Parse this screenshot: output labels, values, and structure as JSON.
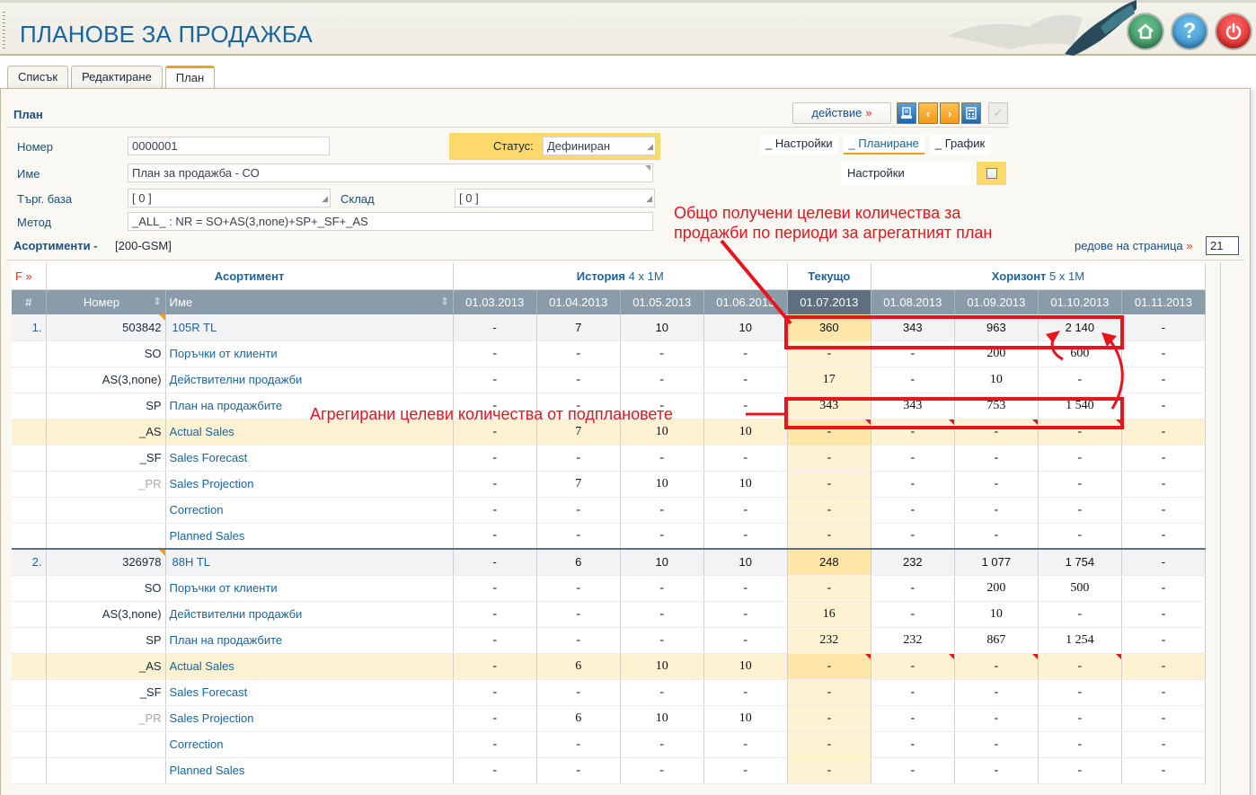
{
  "app": {
    "title": "ПЛАНОВЕ ЗА ПРОДАЖБА",
    "header_buttons": [
      {
        "name": "home",
        "icon": "home-icon"
      },
      {
        "name": "help",
        "icon": "help-icon",
        "glyph": "?"
      },
      {
        "name": "power",
        "icon": "power-icon"
      }
    ]
  },
  "tabs": [
    {
      "label": "Списък",
      "active": false
    },
    {
      "label": "Редактиране",
      "active": false
    },
    {
      "label": "План",
      "active": true
    }
  ],
  "plan": {
    "section_title": "План",
    "action_label": "действие",
    "action_suffix": "»",
    "toolbar": [
      "print-icon",
      "chevron-left-icon",
      "chevron-right-icon",
      "calculator-icon",
      "check-icon"
    ],
    "fields": {
      "number_label": "Номер",
      "number_value": "0000001",
      "status_label": "Статус:",
      "status_value": "Дефиниран",
      "name_label": "Име",
      "name_value": "План за продажба - СО",
      "trade_base_label": "Търг. база",
      "trade_base_value": "[ 0 ]",
      "warehouse_label": "Склад",
      "warehouse_value": "[ 0 ]",
      "method_label": "Метод",
      "method_value": "_ALL_ : NR = SO+AS(3,none)+SP+_SF+_AS"
    },
    "subtabs": [
      {
        "label": "_ Настройки",
        "active": false
      },
      {
        "label": "_ Планиране",
        "active": true
      },
      {
        "label": "_ График",
        "active": false
      }
    ],
    "settings_label": "Настройки",
    "settings_checked": false
  },
  "assortments": {
    "title": "Асортименти -",
    "code": "[200-GSM]",
    "rows_per_page_label": "редове на страница",
    "rows_per_page_suffix": "»",
    "rows_per_page_value": "21"
  },
  "annotations": {
    "top": [
      "Общо получени целеви количества за",
      "продажби по периоди за агрегатният план"
    ],
    "middle": "Агрегирани целеви количества от подплановете"
  },
  "grid": {
    "filter_label": "F »",
    "group_headers": {
      "assortment": "Асортимент",
      "history": "История",
      "history_detail": "4 x 1M",
      "current": "Текущо",
      "horizon": "Хоризонт",
      "horizon_detail": "5 x 1M"
    },
    "columns": {
      "index": "#",
      "number": "Номер",
      "name": "Име",
      "periods": [
        "01.03.2013",
        "01.04.2013",
        "01.05.2013",
        "01.06.2013",
        "01.07.2013",
        "01.08.2013",
        "01.09.2013",
        "01.10.2013",
        "01.11.2013"
      ],
      "current_period_index": 4
    },
    "items": [
      {
        "index": "1.",
        "number": "503842",
        "name": "105R TL",
        "values": [
          "-",
          "7",
          "10",
          "10",
          "360",
          "343",
          "963",
          "2 140",
          "-"
        ],
        "rows": [
          {
            "code": "SO",
            "name": "Поръчки от клиенти",
            "values": [
              "-",
              "-",
              "-",
              "-",
              "-",
              "-",
              "200",
              "600",
              "-"
            ]
          },
          {
            "code": "AS(3,none)",
            "name": "Действителни продажби",
            "values": [
              "-",
              "-",
              "-",
              "-",
              "17",
              "-",
              "10",
              "-",
              "-"
            ]
          },
          {
            "code": "SP",
            "name": "План на продажбите",
            "values": [
              "-",
              "-",
              "-",
              "-",
              "343",
              "343",
              "753",
              "1 540",
              "-"
            ]
          },
          {
            "code": "_AS",
            "name": "Actual Sales",
            "values": [
              "-",
              "7",
              "10",
              "10",
              "-",
              "-",
              "-",
              "-",
              "-"
            ],
            "highlight": true
          },
          {
            "code": "_SF",
            "name": "Sales Forecast",
            "values": [
              "-",
              "-",
              "-",
              "-",
              "-",
              "-",
              "-",
              "-",
              "-"
            ]
          },
          {
            "code": "_PR",
            "name": "Sales Projection",
            "values": [
              "-",
              "7",
              "10",
              "10",
              "-",
              "-",
              "-",
              "-",
              "-"
            ],
            "dim": true
          },
          {
            "code": "",
            "name": "Correction",
            "values": [
              "-",
              "-",
              "-",
              "-",
              "-",
              "-",
              "-",
              "-",
              "-"
            ]
          },
          {
            "code": "",
            "name": "Planned Sales",
            "values": [
              "-",
              "-",
              "-",
              "-",
              "-",
              "-",
              "-",
              "-",
              "-"
            ]
          }
        ]
      },
      {
        "index": "2.",
        "number": "326978",
        "name": "88H TL",
        "values": [
          "-",
          "6",
          "10",
          "10",
          "248",
          "232",
          "1 077",
          "1 754",
          "-"
        ],
        "rows": [
          {
            "code": "SO",
            "name": "Поръчки от клиенти",
            "values": [
              "-",
              "-",
              "-",
              "-",
              "-",
              "-",
              "200",
              "500",
              "-"
            ]
          },
          {
            "code": "AS(3,none)",
            "name": "Действителни продажби",
            "values": [
              "-",
              "-",
              "-",
              "-",
              "16",
              "-",
              "10",
              "-",
              "-"
            ]
          },
          {
            "code": "SP",
            "name": "План на продажбите",
            "values": [
              "-",
              "-",
              "-",
              "-",
              "232",
              "232",
              "867",
              "1 254",
              "-"
            ]
          },
          {
            "code": "_AS",
            "name": "Actual Sales",
            "values": [
              "-",
              "6",
              "10",
              "10",
              "-",
              "-",
              "-",
              "-",
              "-"
            ],
            "highlight": true
          },
          {
            "code": "_SF",
            "name": "Sales Forecast",
            "values": [
              "-",
              "-",
              "-",
              "-",
              "-",
              "-",
              "-",
              "-",
              "-"
            ]
          },
          {
            "code": "_PR",
            "name": "Sales Projection",
            "values": [
              "-",
              "6",
              "10",
              "10",
              "-",
              "-",
              "-",
              "-",
              "-"
            ],
            "dim": true
          },
          {
            "code": "",
            "name": "Correction",
            "values": [
              "-",
              "-",
              "-",
              "-",
              "-",
              "-",
              "-",
              "-",
              "-"
            ]
          },
          {
            "code": "",
            "name": "Planned Sales",
            "values": [
              "-",
              "-",
              "-",
              "-",
              "-",
              "-",
              "-",
              "-",
              "-"
            ]
          }
        ]
      }
    ]
  },
  "colors": {
    "title_blue": "#1a64a0",
    "accent_orange": "#f0a020",
    "status_yellow": "#fdd86a",
    "annotation_red": "#e8141c",
    "header_gray": "#8a9caa",
    "current_col": "#5d6f80"
  }
}
